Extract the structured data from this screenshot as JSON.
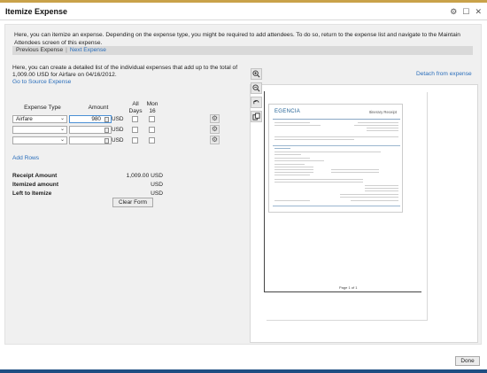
{
  "window": {
    "title": "Itemize Expense",
    "icons": [
      "gear-icon",
      "maximize-icon",
      "close-icon"
    ]
  },
  "intro_text": "Here, you can itemize an expense. Depending on the expense type, you might be required to add attendees. To do so, return to the expense list and navigate to the Maintain Attendees screen of this expense.",
  "nav": {
    "previous": "Previous Expense",
    "separator": "|",
    "next": "Next Expense"
  },
  "description": {
    "text": "Here, you can create a detailed list of the individual expenses that add up to the total of 1,009.00 USD for Airfare on 04/16/2012.",
    "source_link": "Go to Source Expense",
    "detach_link": "Detach from expense"
  },
  "table": {
    "headers": {
      "expense_type": "Expense Type",
      "amount": "Amount",
      "all_days": "All Days",
      "mon": "Mon 16"
    },
    "rows": [
      {
        "expense_type": "Airfare",
        "amount": "980",
        "currency": "USD"
      },
      {
        "expense_type": "",
        "amount": "",
        "currency": "USD"
      },
      {
        "expense_type": "",
        "amount": "",
        "currency": "USD"
      }
    ]
  },
  "add_rows": "Add Rows",
  "summary": {
    "receipt_label": "Receipt Amount",
    "receipt_value": "1,009.00 USD",
    "itemized_label": "Itemized amount",
    "itemized_value": "USD",
    "left_label": "Left to Itemize",
    "left_value": "USD"
  },
  "clear_button": "Clear Form",
  "viewer": {
    "brand": "EGENCIA",
    "doc_title": "Itinerary Receipt",
    "page_label": "Page 1 of 1",
    "tools": [
      "zoom-in-icon",
      "zoom-out-icon",
      "rotate-icon",
      "copy-icon"
    ]
  },
  "done_button": "Done",
  "colors": {
    "accent_link": "#2a6ebb",
    "top_bar": "#c9a24a",
    "bottom_bar": "#1f4e82"
  }
}
